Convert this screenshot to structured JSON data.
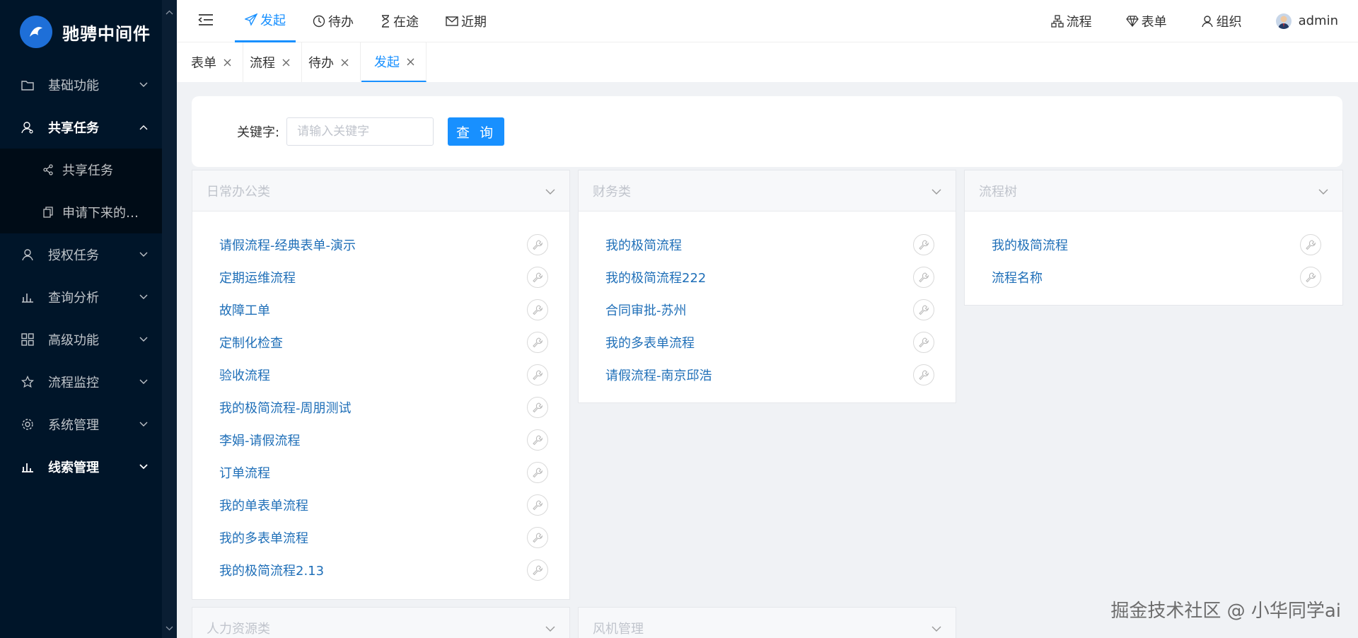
{
  "app": {
    "logo_text": "驰骋中间件"
  },
  "sidebar": {
    "items": [
      {
        "label": "基础功能",
        "icon": "folder-icon"
      },
      {
        "label": "共享任务",
        "icon": "user-share-icon",
        "open": true,
        "children": [
          {
            "label": "共享任务",
            "icon": "share-icon"
          },
          {
            "label": "申请下来的…",
            "icon": "copy-icon"
          }
        ]
      },
      {
        "label": "授权任务",
        "icon": "user-auth-icon"
      },
      {
        "label": "查询分析",
        "icon": "bar-chart-icon"
      },
      {
        "label": "高级功能",
        "icon": "grid-icon"
      },
      {
        "label": "流程监控",
        "icon": "star-icon"
      },
      {
        "label": "系统管理",
        "icon": "gear-icon"
      },
      {
        "label": "线索管理",
        "icon": "bar-chart-icon"
      }
    ]
  },
  "header": {
    "nav": [
      {
        "label": "发起",
        "icon": "send-icon",
        "active": true
      },
      {
        "label": "待办",
        "icon": "clock-icon"
      },
      {
        "label": "在途",
        "icon": "hourglass-icon"
      },
      {
        "label": "近期",
        "icon": "mail-icon"
      }
    ],
    "right": [
      {
        "label": "流程",
        "icon": "flow-icon"
      },
      {
        "label": "表单",
        "icon": "diamond-icon"
      },
      {
        "label": "组织",
        "icon": "user-icon"
      }
    ],
    "user": "admin"
  },
  "tabs": [
    {
      "label": "表单"
    },
    {
      "label": "流程"
    },
    {
      "label": "待办"
    },
    {
      "label": "发起",
      "active": true
    }
  ],
  "search": {
    "label": "关键字:",
    "placeholder": "请输入关键字",
    "button": "查 询"
  },
  "panels": {
    "daily": {
      "title": "日常办公类",
      "flows": [
        "请假流程-经典表单-演示",
        "定期运维流程",
        "故障工单",
        "定制化检查",
        "验收流程",
        "我的极简流程-周朋测试",
        "李娟-请假流程",
        "订单流程",
        "我的单表单流程",
        "我的多表单流程",
        "我的极简流程2.13"
      ]
    },
    "finance": {
      "title": "财务类",
      "flows": [
        "我的极简流程",
        "我的极简流程222",
        "合同审批-苏州",
        "我的多表单流程",
        "请假流程-南京邱浩"
      ]
    },
    "tree": {
      "title": "流程树",
      "flows": [
        "我的极简流程",
        "流程名称"
      ]
    },
    "hr": {
      "title": "人力资源类"
    },
    "risk": {
      "title": "风机管理"
    }
  },
  "watermark": "掘金技术社区 @ 小华同学ai",
  "colors": {
    "sidebar_bg": "#001529",
    "primary": "#1890ff",
    "link": "#1f6fb8"
  }
}
